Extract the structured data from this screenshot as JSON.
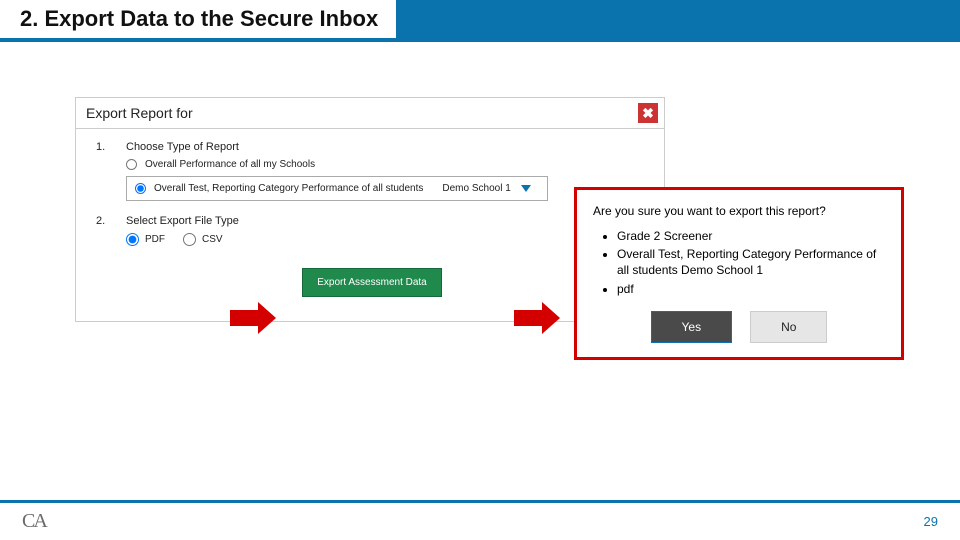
{
  "slide": {
    "title": "2. Export Data to the Secure Inbox",
    "page_number": "29"
  },
  "export_panel": {
    "title": "Export Report for",
    "close_label": "✖",
    "step1": {
      "num": "1.",
      "title": "Choose Type of Report",
      "opt_all_schools": "Overall Performance of all my Schools",
      "opt_all_students": "Overall Test, Reporting Category Performance of all students",
      "school_selected": "Demo School 1"
    },
    "step2": {
      "num": "2.",
      "title": "Select Export File Type",
      "opt_pdf": "PDF",
      "opt_csv": "CSV"
    },
    "export_button": "Export Assessment Data"
  },
  "confirm": {
    "question": "Are you sure you want to export this report?",
    "items": [
      "Grade 2 Screener",
      "Overall Test, Reporting Category Performance of all students Demo School 1",
      "pdf"
    ],
    "yes": "Yes",
    "no": "No"
  },
  "logo_text": "CA"
}
